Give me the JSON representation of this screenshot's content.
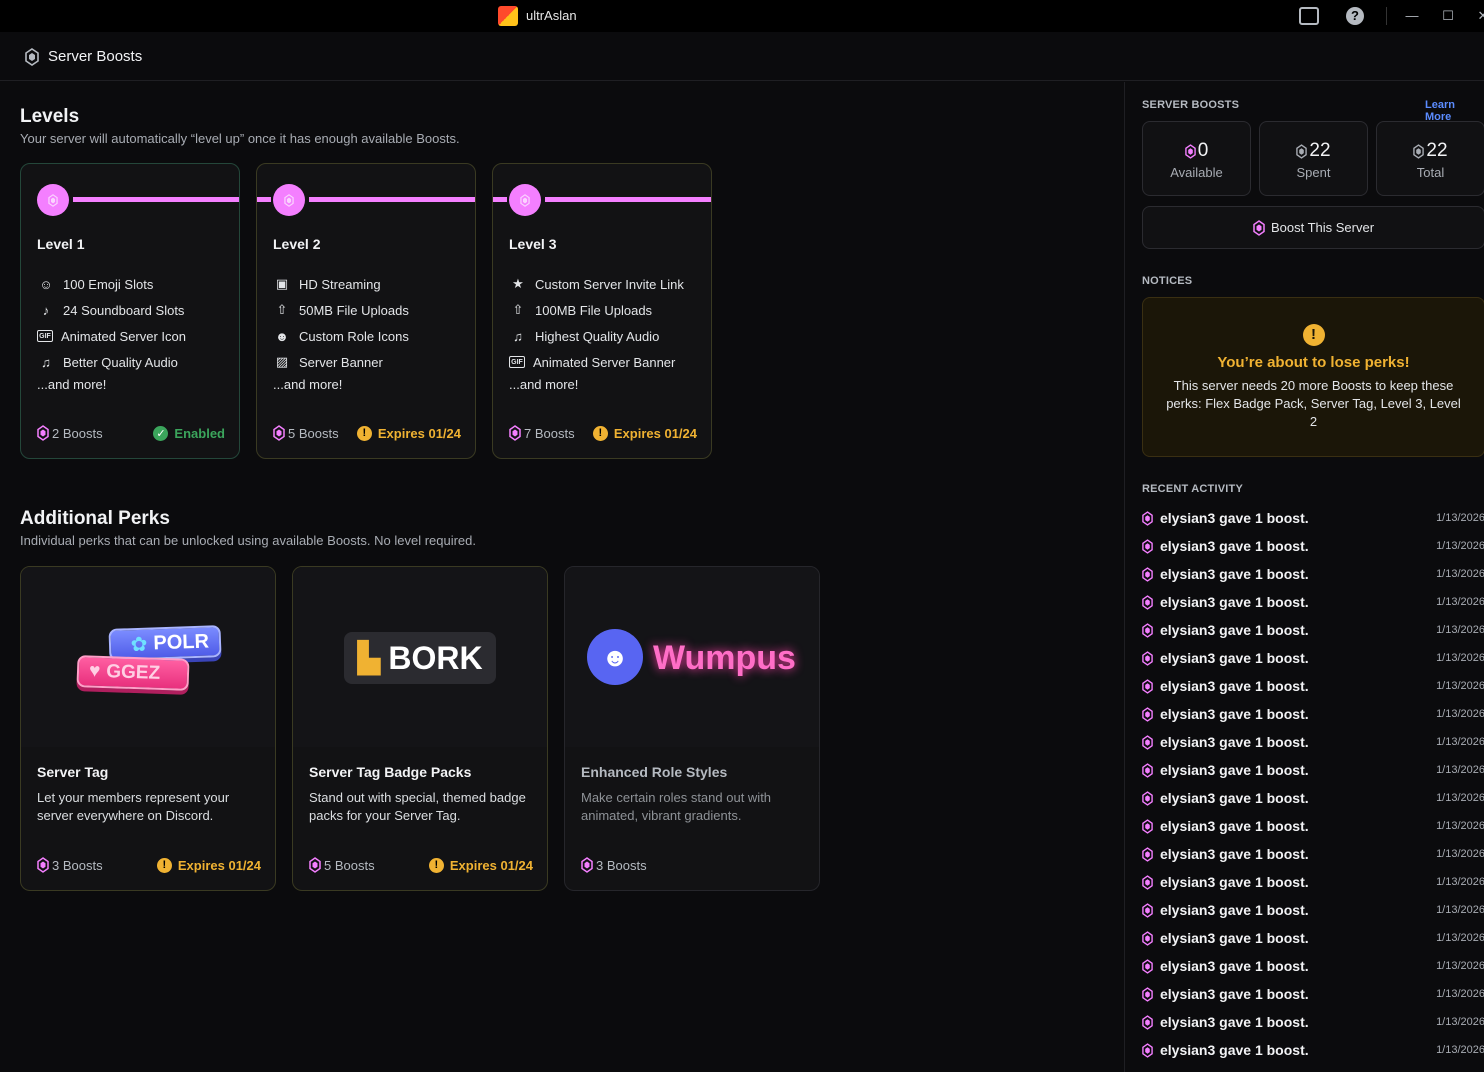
{
  "app": {
    "title": "ultrAslan"
  },
  "header": {
    "title": "Server Boosts"
  },
  "levels": {
    "title": "Levels",
    "subtitle": "Your server will automatically “level up” once it has enough available Boosts.",
    "cards": [
      {
        "name": "Level 1",
        "perks": [
          {
            "icon": "emoji-icon",
            "label": "100 Emoji Slots"
          },
          {
            "icon": "soundboard-icon",
            "label": "24 Soundboard Slots"
          },
          {
            "icon": "gif-icon",
            "label": "Animated Server Icon"
          },
          {
            "icon": "headphones-icon",
            "label": "Better Quality Audio"
          }
        ],
        "more": "...and more!",
        "boosts": "2 Boosts",
        "status": "Enabled"
      },
      {
        "name": "Level 2",
        "perks": [
          {
            "icon": "screen-share-icon",
            "label": "HD Streaming"
          },
          {
            "icon": "upload-icon",
            "label": "50MB File Uploads"
          },
          {
            "icon": "role-icon",
            "label": "Custom Role Icons"
          },
          {
            "icon": "image-icon",
            "label": "Server Banner"
          }
        ],
        "more": "...and more!",
        "boosts": "5 Boosts",
        "status": "Expires 01/24"
      },
      {
        "name": "Level 3",
        "perks": [
          {
            "icon": "star-icon",
            "label": "Custom Server Invite Link"
          },
          {
            "icon": "upload-icon",
            "label": "100MB File Uploads"
          },
          {
            "icon": "headphones-icon",
            "label": "Highest Quality Audio"
          },
          {
            "icon": "gif-icon",
            "label": "Animated Server Banner"
          }
        ],
        "more": "...and more!",
        "boosts": "7 Boosts",
        "status": "Expires 01/24"
      }
    ]
  },
  "additional": {
    "title": "Additional Perks",
    "subtitle": "Individual perks that can be unlocked using available Boosts. No level required.",
    "cards": [
      {
        "name": "Server Tag",
        "desc": "Let your members represent your server everywhere on Discord.",
        "boosts": "3 Boosts",
        "status": "Expires 01/24",
        "art": [
          "POLR",
          "GGEZ"
        ]
      },
      {
        "name": "Server Tag Badge Packs",
        "desc": "Stand out with special, themed badge packs for your Server Tag.",
        "boosts": "5 Boosts",
        "status": "Expires 01/24",
        "art": [
          "BORK"
        ]
      },
      {
        "name": "Enhanced Role Styles",
        "desc": "Make certain roles stand out with animated, vibrant gradients.",
        "boosts": "3 Boosts",
        "status": "",
        "art": [
          "Wumpus"
        ]
      }
    ]
  },
  "sidebar": {
    "boosts_heading": "SERVER BOOSTS",
    "learn_more": "Learn More",
    "stats": [
      {
        "value": "0",
        "label": "Available"
      },
      {
        "value": "22",
        "label": "Spent"
      },
      {
        "value": "22",
        "label": "Total"
      }
    ],
    "boost_button": "Boost This Server",
    "notices_heading": "NOTICES",
    "notice": {
      "title": "You’re about to lose perks!",
      "text": "This server needs 20 more Boosts to keep these perks: Flex Badge Pack, Server Tag, Level 3, Level 2"
    },
    "activity_heading": "RECENT ACTIVITY",
    "activity": [
      {
        "text": "elysian3 gave 1 boost.",
        "date": "1/13/2026"
      },
      {
        "text": "elysian3 gave 1 boost.",
        "date": "1/13/2026"
      },
      {
        "text": "elysian3 gave 1 boost.",
        "date": "1/13/2026"
      },
      {
        "text": "elysian3 gave 1 boost.",
        "date": "1/13/2026"
      },
      {
        "text": "elysian3 gave 1 boost.",
        "date": "1/13/2026"
      },
      {
        "text": "elysian3 gave 1 boost.",
        "date": "1/13/2026"
      },
      {
        "text": "elysian3 gave 1 boost.",
        "date": "1/13/2026"
      },
      {
        "text": "elysian3 gave 1 boost.",
        "date": "1/13/2026"
      },
      {
        "text": "elysian3 gave 1 boost.",
        "date": "1/13/2026"
      },
      {
        "text": "elysian3 gave 1 boost.",
        "date": "1/13/2026"
      },
      {
        "text": "elysian3 gave 1 boost.",
        "date": "1/13/2026"
      },
      {
        "text": "elysian3 gave 1 boost.",
        "date": "1/13/2026"
      },
      {
        "text": "elysian3 gave 1 boost.",
        "date": "1/13/2026"
      },
      {
        "text": "elysian3 gave 1 boost.",
        "date": "1/13/2026"
      },
      {
        "text": "elysian3 gave 1 boost.",
        "date": "1/13/2026"
      },
      {
        "text": "elysian3 gave 1 boost.",
        "date": "1/13/2026"
      },
      {
        "text": "elysian3 gave 1 boost.",
        "date": "1/13/2026"
      },
      {
        "text": "elysian3 gave 1 boost.",
        "date": "1/13/2026"
      },
      {
        "text": "elysian3 gave 1 boost.",
        "date": "1/13/2026"
      },
      {
        "text": "elysian3 gave 1 boost.",
        "date": "1/13/2026"
      }
    ]
  },
  "colors": {
    "boost_pink": "#f47fff",
    "enabled_green": "#3ba55c",
    "warning_yellow": "#f0b232",
    "link_blue": "#5b8cff"
  }
}
